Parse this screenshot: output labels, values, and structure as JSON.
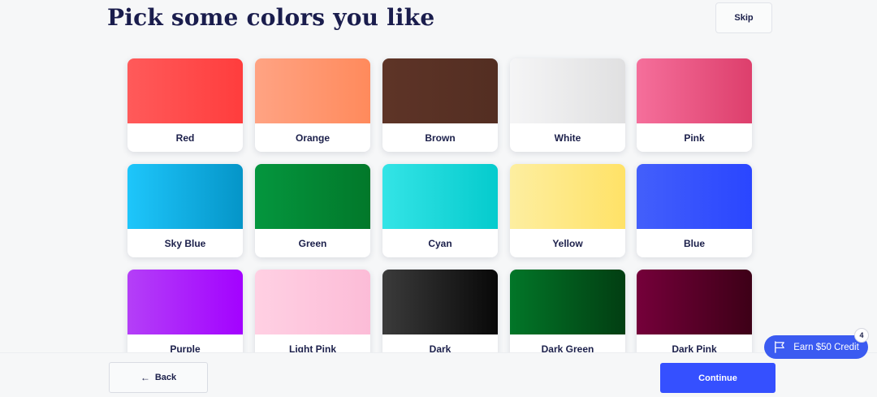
{
  "page": {
    "title": "Pick some colors you like"
  },
  "header": {
    "skip_label": "Skip"
  },
  "colors": [
    {
      "label": "Red",
      "from": "#ff5a5a",
      "to": "#ff3d3d"
    },
    {
      "label": "Orange",
      "from": "#ffa383",
      "to": "#ff8a5c"
    },
    {
      "label": "Brown",
      "from": "#5e3427",
      "to": "#532e22"
    },
    {
      "label": "White",
      "from": "#f5f5f6",
      "to": "#e0e0e1"
    },
    {
      "label": "Pink",
      "from": "#f56f9b",
      "to": "#dd3f6c"
    },
    {
      "label": "Sky Blue",
      "from": "#1ec6fb",
      "to": "#0595c8"
    },
    {
      "label": "Green",
      "from": "#04963e",
      "to": "#02782a"
    },
    {
      "label": "Cyan",
      "from": "#34e4e6",
      "to": "#05cbcd"
    },
    {
      "label": "Yellow",
      "from": "#fdeea0",
      "to": "#ffe267"
    },
    {
      "label": "Blue",
      "from": "#435ffb",
      "to": "#2a46ff"
    },
    {
      "label": "Purple",
      "from": "#b43ff7",
      "to": "#a302ff"
    },
    {
      "label": "Light Pink",
      "from": "#ffd0e3",
      "to": "#fcbcd7"
    },
    {
      "label": "Dark",
      "from": "#3b3b3b",
      "to": "#080808"
    },
    {
      "label": "Dark Green",
      "from": "#027628",
      "to": "#023e12"
    },
    {
      "label": "Dark Pink",
      "from": "#75003a",
      "to": "#3d0017"
    }
  ],
  "footer": {
    "back_label": "Back",
    "continue_label": "Continue"
  },
  "earn": {
    "label": "Earn $50 Credit",
    "badge": "4",
    "icon": "flag-icon"
  }
}
